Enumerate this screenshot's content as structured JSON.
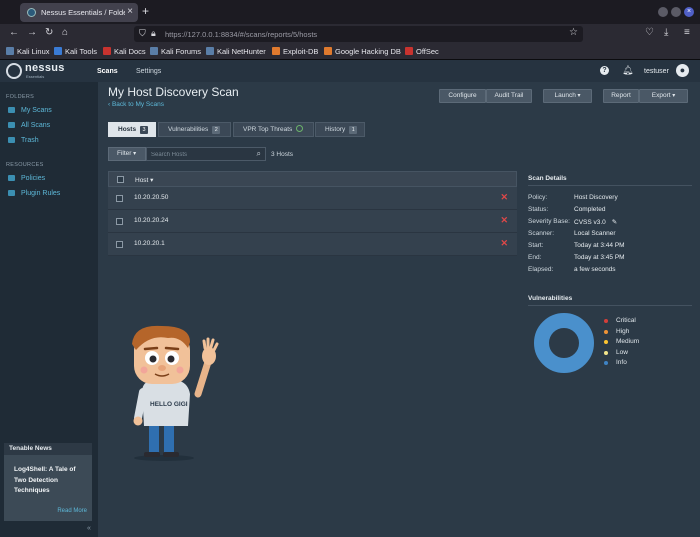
{
  "browser": {
    "tab_title": "Nessus Essentials / Folde",
    "new_tab": "+",
    "url_host": "https://127.0.0.1",
    "url_rest": ":8834/#/scans/reports/5/hosts",
    "bookmarks": [
      "Kali Linux",
      "Kali Tools",
      "Kali Docs",
      "Kali Forums",
      "Kali NetHunter",
      "Exploit-DB",
      "Google Hacking DB",
      "OffSec"
    ]
  },
  "header": {
    "logo": "nessus",
    "logo_sub": "Essentials",
    "nav": [
      "Scans",
      "Settings"
    ],
    "help": "?",
    "user": "testuser"
  },
  "sidebar": {
    "folders_label": "FOLDERS",
    "folders": [
      "My Scans",
      "All Scans",
      "Trash"
    ],
    "resources_label": "RESOURCES",
    "resources": [
      "Policies",
      "Plugin Rules"
    ],
    "news_title": "Tenable News",
    "news_item": "Log4Shell: A Tale of Two Detection Techniques",
    "news_more": "Read More",
    "collapse": "«"
  },
  "main": {
    "title": "My Host Discovery Scan",
    "back": "‹ Back to My Scans",
    "buttons": {
      "configure": "Configure",
      "audit_trail": "Audit Trail",
      "launch": "Launch",
      "report": "Report",
      "export": "Export"
    },
    "tabs": [
      {
        "label": "Hosts",
        "count": "3"
      },
      {
        "label": "Vulnerabilities",
        "count": "2"
      },
      {
        "label": "VPR Top Threats"
      },
      {
        "label": "History",
        "count": "1"
      }
    ],
    "filter": "Filter",
    "search_placeholder": "Search Hosts",
    "host_count": "3 Hosts",
    "table_header": "Host ▾",
    "hosts": [
      "10.20.20.50",
      "10.20.20.24",
      "10.20.20.1"
    ],
    "delete_symbol": "✕"
  },
  "scan_details": {
    "title": "Scan Details",
    "rows": [
      {
        "k": "Policy:",
        "v": "Host Discovery"
      },
      {
        "k": "Status:",
        "v": "Completed"
      },
      {
        "k": "Severity Base:",
        "v": "CVSS v3.0"
      },
      {
        "k": "Scanner:",
        "v": "Local Scanner"
      },
      {
        "k": "Start:",
        "v": "Today at 3:44 PM"
      },
      {
        "k": "End:",
        "v": "Today at 3:45 PM"
      },
      {
        "k": "Elapsed:",
        "v": "a few seconds"
      }
    ]
  },
  "vulnerabilities": {
    "title": "Vulnerabilities",
    "legend": [
      {
        "label": "Critical",
        "color": "#d43f3a"
      },
      {
        "label": "High",
        "color": "#ee9336"
      },
      {
        "label": "Medium",
        "color": "#fdc431"
      },
      {
        "label": "Low",
        "color": "#3fae49"
      },
      {
        "label": "Info",
        "color": "#3f83c4"
      }
    ],
    "donut_color": "#4a90cc"
  },
  "mascot": {
    "shirt_text": "HELLO GIGI"
  }
}
